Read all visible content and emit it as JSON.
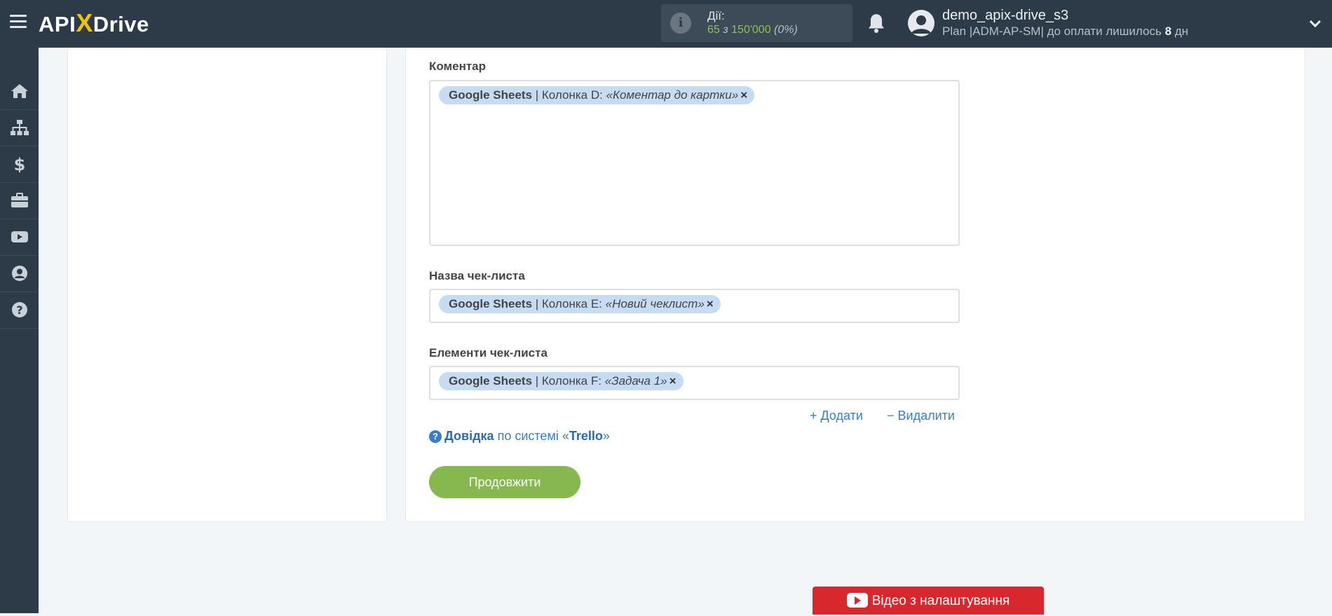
{
  "header": {
    "logo_left": "API",
    "logo_x": "X",
    "logo_right": "Drive",
    "actions_label": "Дії:",
    "actions_used": "65",
    "actions_of": "з",
    "actions_total": "150'000",
    "actions_pct": "(0%)",
    "username": "demo_apix-drive_s3",
    "plan_text": "Plan |ADM-AP-SM| до оплати лишилось",
    "plan_days": "8",
    "plan_days_unit": "дн"
  },
  "sidebar": {
    "items": [
      "home-icon",
      "sitemap-icon",
      "dollar-icon",
      "briefcase-icon",
      "youtube-icon",
      "user-icon",
      "help-icon"
    ]
  },
  "form": {
    "fields": [
      {
        "label": "Коментар",
        "tag_source": "Google Sheets",
        "tag_column": "| Колонка D:",
        "tag_value": "«Коментар до картки»",
        "tag_remove": "×"
      },
      {
        "label": "Назва чек-листа",
        "tag_source": "Google Sheets",
        "tag_column": "| Колонка E:",
        "tag_value": "«Новий чеклист»",
        "tag_remove": "×"
      },
      {
        "label": "Елементи чек-листа",
        "tag_source": "Google Sheets",
        "tag_column": "| Колонка F:",
        "tag_value": "«Задача 1»",
        "tag_remove": "×"
      }
    ],
    "add_label": "+ Додати",
    "remove_label": "− Видалити",
    "help_link": "Довідка",
    "help_middle": "по системі «",
    "help_system": "Trello",
    "help_end": "»",
    "continue_button": "Продовжити",
    "video_button": "Відео з налаштування"
  },
  "colors": {
    "header_bg": "#2d3a48",
    "accent_green": "#87b84f",
    "link_blue": "#3b7dc4",
    "tag_bg": "#c6dcf3",
    "video_red": "#d9272e"
  }
}
